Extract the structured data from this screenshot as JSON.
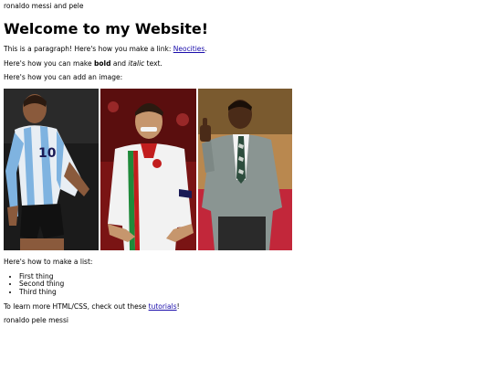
{
  "top_text": "ronaldo messi and pele",
  "heading": "Welcome to my Website!",
  "para1": {
    "before": "This is a paragraph! Here's how you make a link: ",
    "link": "Neocities",
    "after": "."
  },
  "para2": {
    "before": "Here's how you can make ",
    "bold": "bold",
    "mid": " and ",
    "italic": "italic",
    "after": " text."
  },
  "para3": "Here's how you can add an image:",
  "image": {
    "description_icons": [
      "messi-photo",
      "ronaldo-photo",
      "pele-photo"
    ],
    "colors": {
      "messi_bg": "#1b1b1b",
      "ronaldo_bg": "#b22222",
      "pele_bg": "#c98c5a"
    }
  },
  "list_intro": "Here's how to make a list:",
  "list": [
    "First thing",
    "Second thing",
    "Third thing"
  ],
  "para4": {
    "before": "To learn more HTML/CSS, check out these ",
    "link": "tutorials",
    "after": "!"
  },
  "bottom_text": "ronaldo pele messi"
}
